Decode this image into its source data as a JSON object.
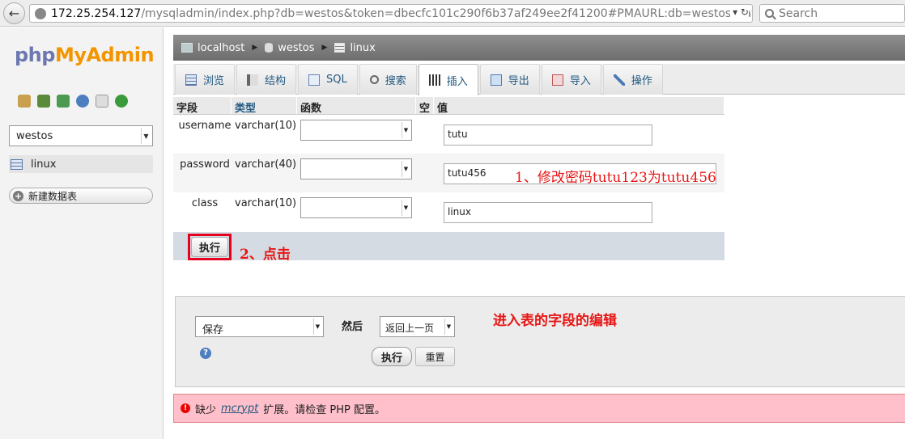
{
  "browser": {
    "url_host": "172.25.254.127",
    "url_path": "/mysqladmin/index.php?db=westos&token=dbecfc101c290f6b37af249ee2f41200#PMAURL:db=westos&tat",
    "search_placeholder": "Search"
  },
  "sidebar": {
    "logo_php": "php",
    "logo_my": "My",
    "logo_admin": "Admin",
    "db_selected": "westos",
    "table_item": "linux",
    "new_db_label": "新建数据表"
  },
  "breadcrumb": {
    "server": "localhost",
    "database": "westos",
    "table": "linux"
  },
  "tabs": [
    {
      "label": "浏览"
    },
    {
      "label": "结构"
    },
    {
      "label": "SQL"
    },
    {
      "label": "搜索"
    },
    {
      "label": "插入"
    },
    {
      "label": "导出"
    },
    {
      "label": "导入"
    },
    {
      "label": "操作"
    }
  ],
  "table_headers": {
    "field": "字段",
    "type": "类型",
    "function": "函数",
    "null": "空",
    "value": "值"
  },
  "rows": [
    {
      "field": "username",
      "type": "varchar(10)",
      "value": "tutu"
    },
    {
      "field": "password",
      "type": "varchar(40)",
      "value": "tutu456"
    },
    {
      "field": "class",
      "type": "varchar(10)",
      "value": "linux"
    }
  ],
  "exec_label": "执行",
  "action_box": {
    "save_option": "保存",
    "after_label": "然后",
    "after_option": "返回上一页",
    "go_label": "执行",
    "reset_label": "重置"
  },
  "error": {
    "prefix": "缺少",
    "link": "mcrypt",
    "suffix": "扩展。请检查 PHP 配置。"
  },
  "annotations": {
    "step1": "1、修改密码tutu123为tutu456",
    "step2": "2、点击",
    "note": "进入表的字段的编辑"
  },
  "colors": {
    "annotation_red": "#e81616",
    "link_blue": "#235a81",
    "error_bg": "#ffc0cb"
  }
}
